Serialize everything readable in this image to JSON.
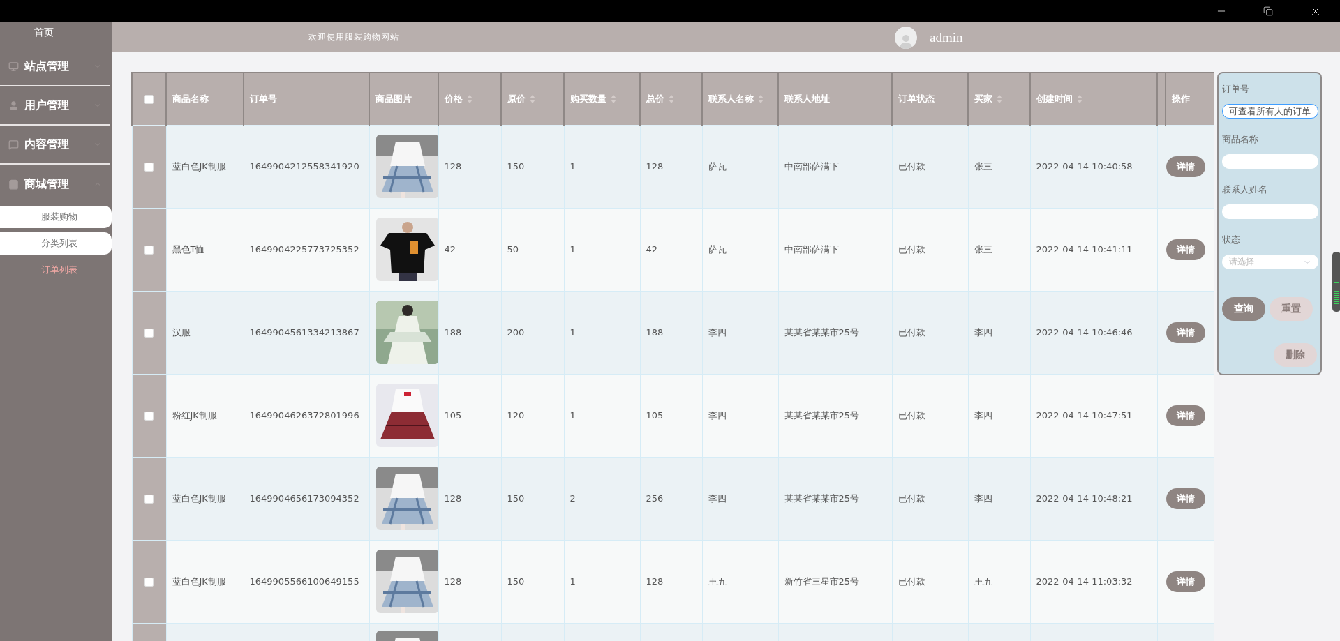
{
  "sidebar": {
    "home": "首页",
    "menus": [
      {
        "label": "站点管理",
        "kind": "monitor",
        "expanded": false
      },
      {
        "label": "用户管理",
        "kind": "user",
        "expanded": false
      },
      {
        "label": "内容管理",
        "kind": "chat",
        "expanded": false
      },
      {
        "label": "商城管理",
        "kind": "bag",
        "expanded": true,
        "children": [
          {
            "label": "服装购物",
            "selected": false
          },
          {
            "label": "分类列表",
            "selected": false
          },
          {
            "label": "订单列表",
            "selected": true
          }
        ]
      }
    ]
  },
  "header": {
    "welcome": "欢迎使用服装购物网站",
    "user": "admin"
  },
  "table": {
    "select_all_checked": false,
    "columns": [
      {
        "label": "商品名称",
        "sortable": false
      },
      {
        "label": "订单号",
        "sortable": false
      },
      {
        "label": "商品图片",
        "sortable": false
      },
      {
        "label": "价格",
        "sortable": true
      },
      {
        "label": "原价",
        "sortable": true
      },
      {
        "label": "购买数量",
        "sortable": true
      },
      {
        "label": "总价",
        "sortable": true
      },
      {
        "label": "联系人名称",
        "sortable": true
      },
      {
        "label": "联系人地址",
        "sortable": false
      },
      {
        "label": "订单状态",
        "sortable": false
      },
      {
        "label": "买家",
        "sortable": true
      },
      {
        "label": "创建时间",
        "sortable": true
      },
      {
        "label": "操作",
        "sortable": false
      }
    ],
    "rows": [
      {
        "checked": false,
        "cells": [
          "蓝白色JK制服",
          "1649904212558341920",
          "128",
          "150",
          "1",
          "128",
          "萨瓦",
          "中南部萨满下",
          "已付款",
          "张三",
          "2022-04-14 10:40:58"
        ],
        "action": "详情"
      },
      {
        "checked": false,
        "cells": [
          "黑色T恤",
          "1649904225773725352",
          "42",
          "50",
          "1",
          "42",
          "萨瓦",
          "中南部萨满下",
          "已付款",
          "张三",
          "2022-04-14 10:41:11"
        ],
        "action": "详情"
      },
      {
        "checked": false,
        "cells": [
          "汉服",
          "1649904561334213867",
          "188",
          "200",
          "1",
          "188",
          "李四",
          "某某省某某市25号",
          "已付款",
          "李四",
          "2022-04-14 10:46:46"
        ],
        "action": "详情"
      },
      {
        "checked": false,
        "cells": [
          "粉红JK制服",
          "1649904626372801996",
          "105",
          "120",
          "1",
          "105",
          "李四",
          "某某省某某市25号",
          "已付款",
          "李四",
          "2022-04-14 10:47:51"
        ],
        "action": "详情"
      },
      {
        "checked": false,
        "cells": [
          "蓝白色JK制服",
          "1649904656173094352",
          "128",
          "150",
          "2",
          "256",
          "李四",
          "某某省某某市25号",
          "已付款",
          "李四",
          "2022-04-14 10:48:21"
        ],
        "action": "详情"
      },
      {
        "checked": false,
        "cells": [
          "蓝白色JK制服",
          "1649905566100649155",
          "128",
          "150",
          "1",
          "128",
          "王五",
          "新竹省三星市25号",
          "已付款",
          "王五",
          "2022-04-14 11:03:32"
        ],
        "action": "详情"
      },
      {
        "kind": "partial"
      }
    ]
  },
  "filter": {
    "fields": [
      {
        "kind": "input",
        "label": "订单号",
        "value": "可查看所有人的订单",
        "focused": true
      },
      {
        "kind": "input",
        "label": "商品名称",
        "focused": false
      },
      {
        "kind": "input",
        "label": "联系人姓名",
        "focused": false
      },
      {
        "kind": "select",
        "label": "状态",
        "placeholder": "请选择"
      }
    ],
    "buttons": [
      {
        "label": "查询",
        "primary": true
      },
      {
        "label": "重置",
        "primary": false
      }
    ],
    "delete_button": {
      "label": "删除",
      "primary": false
    }
  }
}
